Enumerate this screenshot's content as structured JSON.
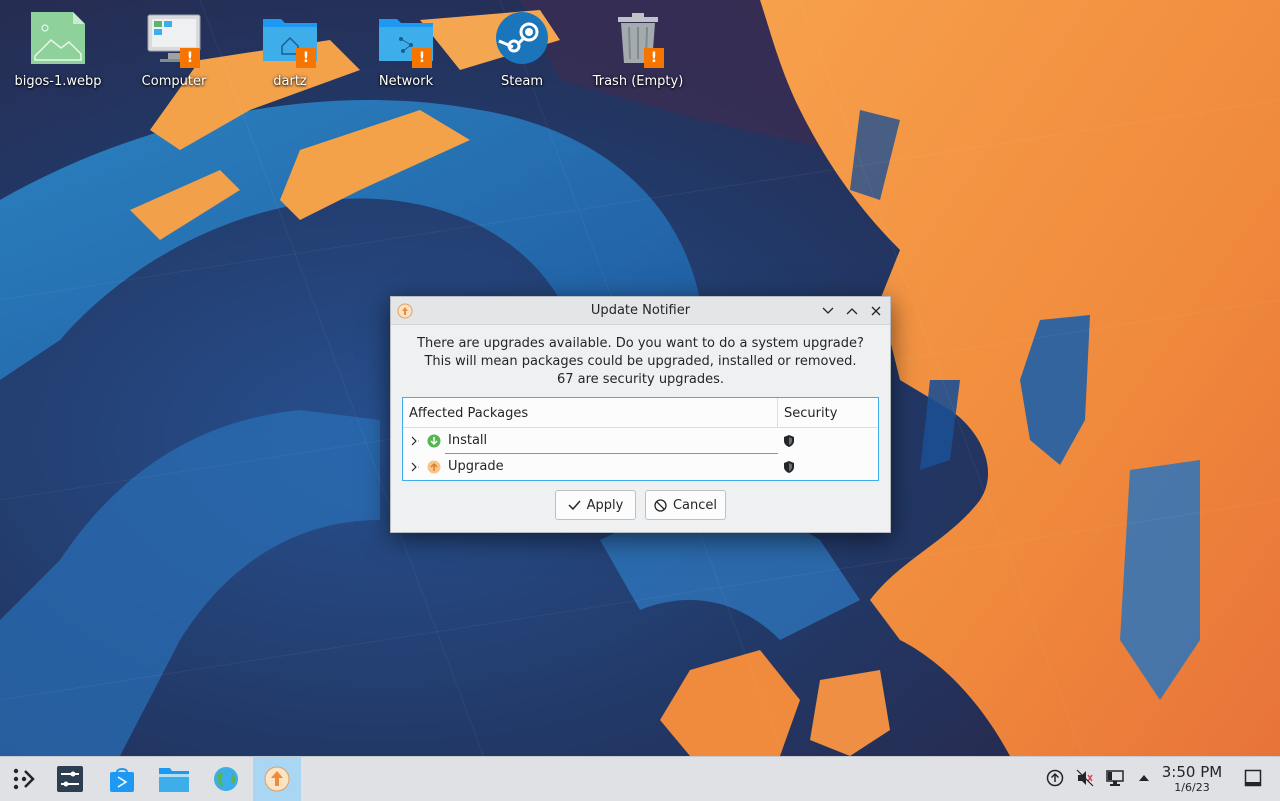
{
  "desktop": {
    "icons": [
      {
        "label": "bigos-1.webp",
        "icon": "image-file-icon",
        "warning": false
      },
      {
        "label": "Computer",
        "icon": "computer-icon",
        "warning": true
      },
      {
        "label": "dartz",
        "icon": "home-folder-icon",
        "warning": true
      },
      {
        "label": "Network",
        "icon": "network-folder-icon",
        "warning": true
      },
      {
        "label": "Steam",
        "icon": "steam-icon",
        "warning": false
      },
      {
        "label": "Trash (Empty)",
        "icon": "trash-icon",
        "warning": true
      }
    ],
    "warning_glyph": "!"
  },
  "dialog": {
    "title": "Update Notifier",
    "message_line1": "There are upgrades available. Do you want to do a system upgrade?",
    "message_line2": "This will mean packages could be upgraded, installed or removed.",
    "message_line3": "67 are security upgrades.",
    "columns": {
      "packages": "Affected Packages",
      "security": "Security"
    },
    "rows": [
      {
        "label": "Install",
        "icon": "install-arrow-icon"
      },
      {
        "label": "Upgrade",
        "icon": "upgrade-arrow-icon"
      }
    ],
    "apply_label": "Apply",
    "cancel_label": "Cancel"
  },
  "taskbar": {
    "apps": [
      "application-launcher-icon",
      "system-settings-icon",
      "discover-store-icon",
      "dolphin-files-icon",
      "web-browser-icon",
      "update-notifier-icon"
    ],
    "tray": [
      "update-available-icon",
      "volume-muted-icon",
      "network-wired-icon",
      "tray-expand-icon"
    ],
    "time": "3:50 PM",
    "date": "1/6/23"
  },
  "colors": {
    "accent": "#3daee9",
    "warning_badge": "#f67400",
    "active_task": "#a9d6f2"
  }
}
